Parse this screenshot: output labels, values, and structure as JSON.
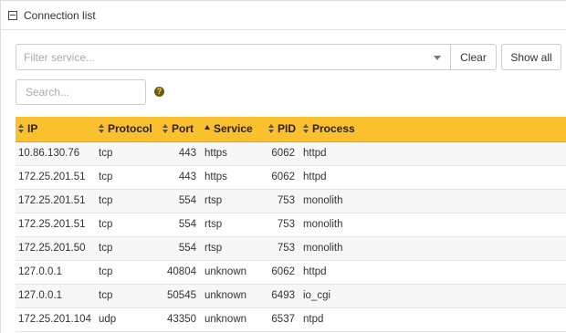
{
  "panel": {
    "title": "Connection list"
  },
  "filter": {
    "placeholder": "Filter service..."
  },
  "buttons": {
    "clear": "Clear",
    "show_all": "Show all"
  },
  "search": {
    "placeholder": "Search..."
  },
  "help": {
    "glyph": "?"
  },
  "table": {
    "columns": [
      "IP",
      "Protocol",
      "Port",
      "Service",
      "PID",
      "Process"
    ],
    "sorted_column": "Service",
    "rows": [
      {
        "ip": "10.86.130.76",
        "protocol": "tcp",
        "port": "443",
        "service": "https",
        "pid": "6062",
        "process": "httpd"
      },
      {
        "ip": "172.25.201.51",
        "protocol": "tcp",
        "port": "443",
        "service": "https",
        "pid": "6062",
        "process": "httpd"
      },
      {
        "ip": "172.25.201.51",
        "protocol": "tcp",
        "port": "554",
        "service": "rtsp",
        "pid": "753",
        "process": "monolith"
      },
      {
        "ip": "172.25.201.51",
        "protocol": "tcp",
        "port": "554",
        "service": "rtsp",
        "pid": "753",
        "process": "monolith"
      },
      {
        "ip": "172.25.201.50",
        "protocol": "tcp",
        "port": "554",
        "service": "rtsp",
        "pid": "753",
        "process": "monolith"
      },
      {
        "ip": "127.0.0.1",
        "protocol": "tcp",
        "port": "40804",
        "service": "unknown",
        "pid": "6062",
        "process": "httpd"
      },
      {
        "ip": "127.0.0.1",
        "protocol": "tcp",
        "port": "50545",
        "service": "unknown",
        "pid": "6493",
        "process": "io_cgi"
      },
      {
        "ip": "172.25.201.104",
        "protocol": "udp",
        "port": "43350",
        "service": "unknown",
        "pid": "6537",
        "process": "ntpd"
      }
    ]
  },
  "colors": {
    "header_accent": "#fbc02d",
    "row_alt": "#f7f7f7"
  },
  "icons": {
    "collapse": "collapse-icon",
    "dropdown": "chevron-down-icon",
    "help": "help-icon",
    "sort": "sort-icon",
    "sort_asc": "sort-asc-icon"
  }
}
